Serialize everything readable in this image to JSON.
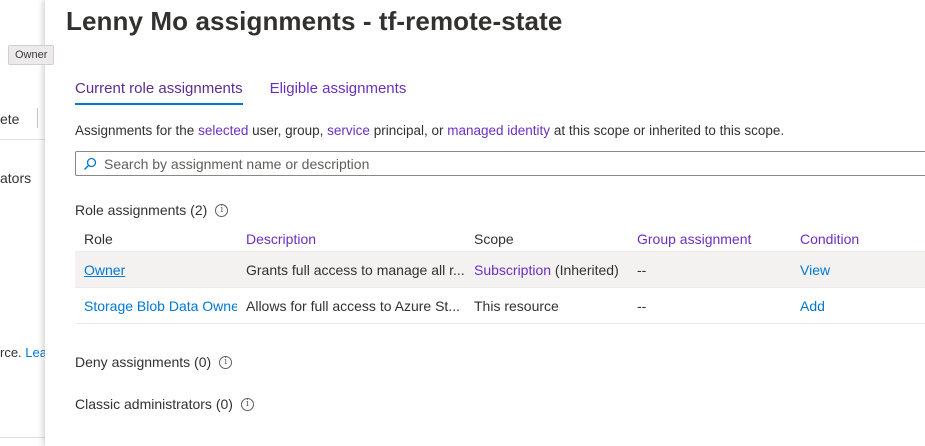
{
  "background": {
    "toolbar_delete": "ete",
    "sidebar_text": "ators",
    "footer_text": "rce.",
    "footer_link": "Lea"
  },
  "tooltip": "Owner",
  "title": "Lenny Mo assignments - tf-remote-state",
  "tabs": [
    {
      "label": "Current role assignments"
    },
    {
      "label": "Eligible assignments"
    }
  ],
  "description": {
    "p1": "Assignments for the ",
    "selected": "selected",
    "p2": " user, group, ",
    "service": "service",
    "p3": " principal, or ",
    "managed": "managed identity",
    "p4": " at this scope or inherited to this scope."
  },
  "search": {
    "placeholder": "Search by assignment name or description"
  },
  "role_assignments": {
    "label": "Role assignments (2)",
    "columns": [
      "Role",
      "Description",
      "Scope",
      "Group assignment",
      "Condition"
    ],
    "rows": [
      {
        "role": "Owner",
        "description": "Grants full access to manage all r...",
        "scope": "Subscription",
        "scope_suffix": " (Inherited)",
        "group": "--",
        "condition": "View"
      },
      {
        "role": "Storage Blob Data Owne",
        "description": "Allows for full access to Azure St...",
        "scope": "This resource",
        "scope_suffix": "",
        "group": "--",
        "condition": "Add"
      }
    ]
  },
  "deny_assignments": {
    "label": "Deny assignments (0)"
  },
  "classic_admins": {
    "label": "Classic administrators (0)"
  },
  "colors": {
    "accent": "#0078d4",
    "purple": "#6b2fbf"
  },
  "icons": {
    "search": "search-icon",
    "info": "info-icon"
  }
}
